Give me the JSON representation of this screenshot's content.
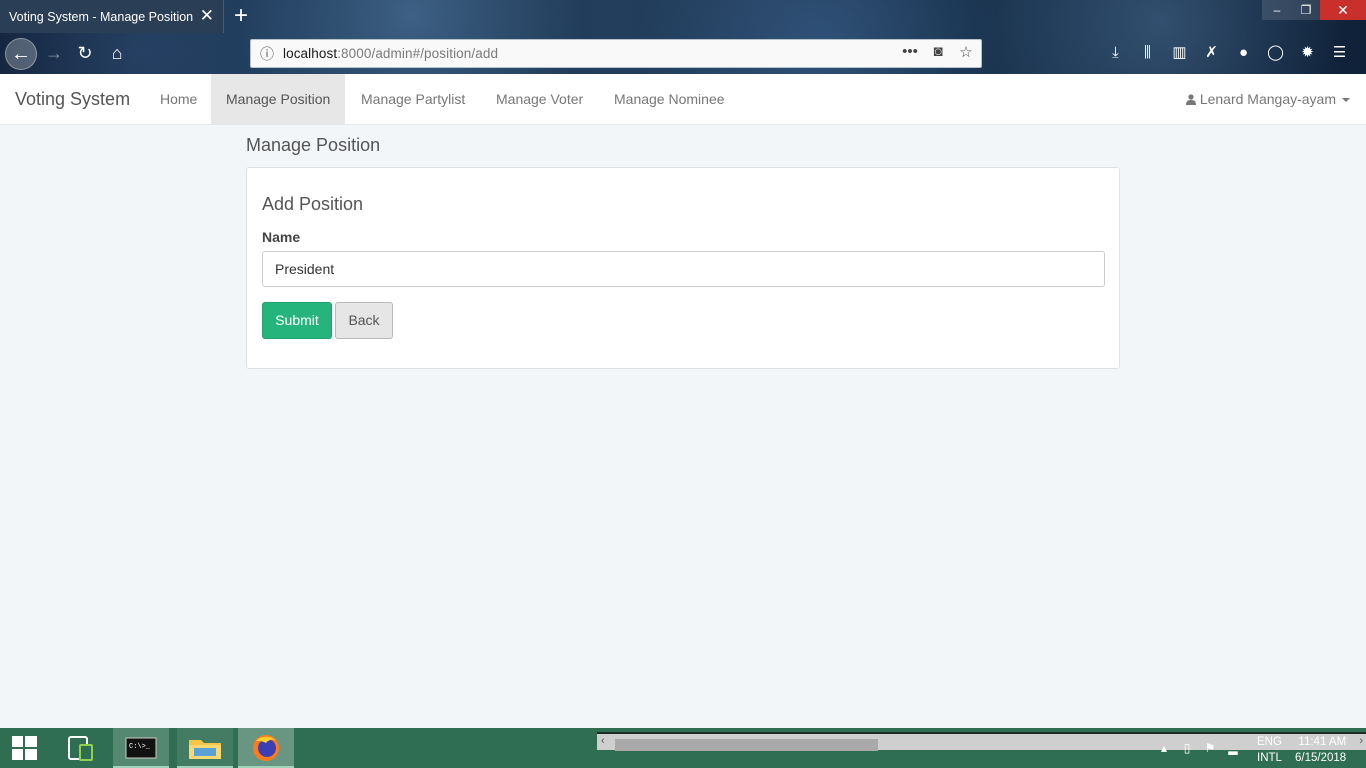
{
  "browser": {
    "tab_title": "Voting System - Manage Position",
    "url_host": "localhost",
    "url_rest": ":8000/admin#/position/add"
  },
  "app": {
    "brand": "Voting System",
    "nav": {
      "home": "Home",
      "manage_position": "Manage Position",
      "manage_partylist": "Manage Partylist",
      "manage_voter": "Manage Voter",
      "manage_nominee": "Manage Nominee"
    },
    "user": "Lenard Mangay-ayam"
  },
  "page": {
    "title": "Manage Position",
    "panel_title": "Add Position",
    "name_label": "Name",
    "name_value": "President",
    "submit_label": "Submit",
    "back_label": "Back"
  },
  "taskbar": {
    "lang_line1": "ENG",
    "lang_line2": "INTL",
    "time": "11:41 AM",
    "date": "6/15/2018"
  },
  "colors": {
    "submit_green": "#26b47d",
    "taskbar": "#2f6e52",
    "page_bg": "#f3f6f9"
  }
}
